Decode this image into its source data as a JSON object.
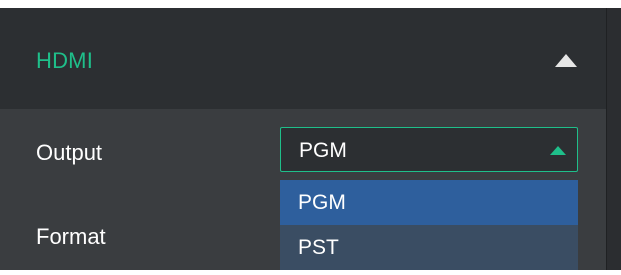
{
  "section": {
    "title": "HDMI",
    "collapse_icon": "triangle-up-icon"
  },
  "output": {
    "label": "Output",
    "selected_value": "PGM",
    "caret_icon": "triangle-up-icon",
    "options": [
      "PGM",
      "PST"
    ],
    "highlighted_option": "PGM"
  },
  "format": {
    "label": "Format"
  },
  "colors": {
    "accent": "#1fbf8a",
    "panel_bg": "#3a3d40",
    "header_bg": "#2c2f32",
    "option_highlight": "#2e5f9d",
    "option_bg": "#3a4d63"
  }
}
